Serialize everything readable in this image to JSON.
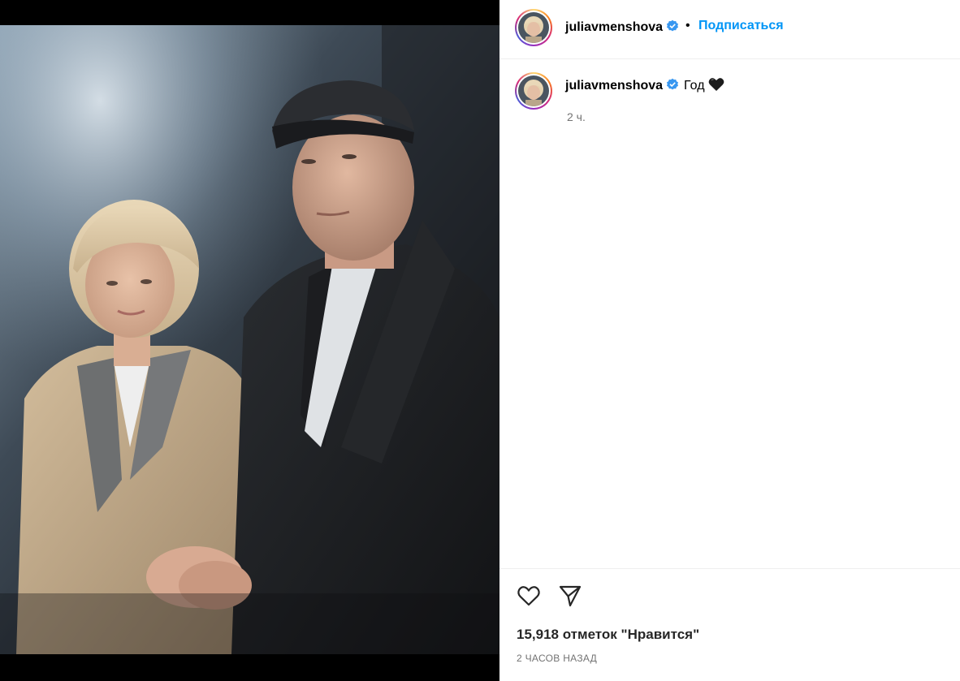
{
  "header": {
    "username": "juliavmenshova",
    "separator": "•",
    "follow_label": "Подписаться"
  },
  "caption": {
    "username": "juliavmenshova",
    "text": "Год",
    "emoji_icon": "black-heart-icon",
    "time": "2 ч."
  },
  "footer": {
    "likes": "15,918 отметок \"Нравится\"",
    "post_age": "2 ЧАСОВ НАЗАД"
  },
  "icons": {
    "verified": "verified-badge-icon",
    "like": "heart-outline-icon",
    "share": "paper-plane-icon"
  },
  "colors": {
    "accent": "#0095f6",
    "verified": "#3897f0",
    "muted": "#737373",
    "media_background": "#000000"
  }
}
